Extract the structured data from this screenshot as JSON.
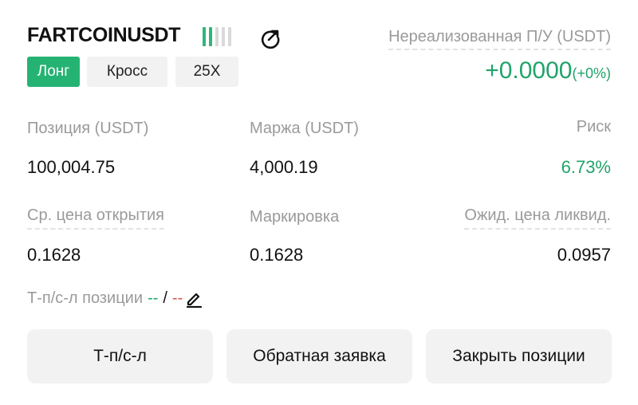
{
  "header": {
    "symbol": "FARTCOINUSDT",
    "signal_bars_active": 2,
    "signal_bars_total": 5,
    "share_icon": "share-icon",
    "unrealized_label": "Нереализованная П/У (USDT)",
    "unrealized_value": "+0.0000",
    "unrealized_percent": "(+0%)"
  },
  "tags": {
    "side": "Лонг",
    "margin_mode": "Кросс",
    "leverage": "25X"
  },
  "stats": {
    "position_label": "Позиция (USDT)",
    "position_value": "100,004.75",
    "margin_label": "Маржа (USDT)",
    "margin_value": "4,000.19",
    "risk_label": "Риск",
    "risk_value": "6.73%",
    "avg_open_label": "Ср. цена открытия",
    "avg_open_value": "0.1628",
    "mark_label": "Маркировка",
    "mark_value": "0.1628",
    "liq_label": "Ожид. цена ликвид.",
    "liq_value": "0.0957"
  },
  "tpsl": {
    "label": "Т-п/с-л позиции",
    "tp": "--",
    "separator": "/",
    "sl": "--",
    "edit_icon": "pencil-icon"
  },
  "buttons": {
    "tpsl": "Т-п/с-л",
    "reverse": "Обратная заявка",
    "close": "Закрыть позиции"
  },
  "colors": {
    "green": "#21a36a",
    "tag_green": "#25b373",
    "red": "#d9534f",
    "muted": "#9a9a9a",
    "button_bg": "#f2f2f2"
  }
}
